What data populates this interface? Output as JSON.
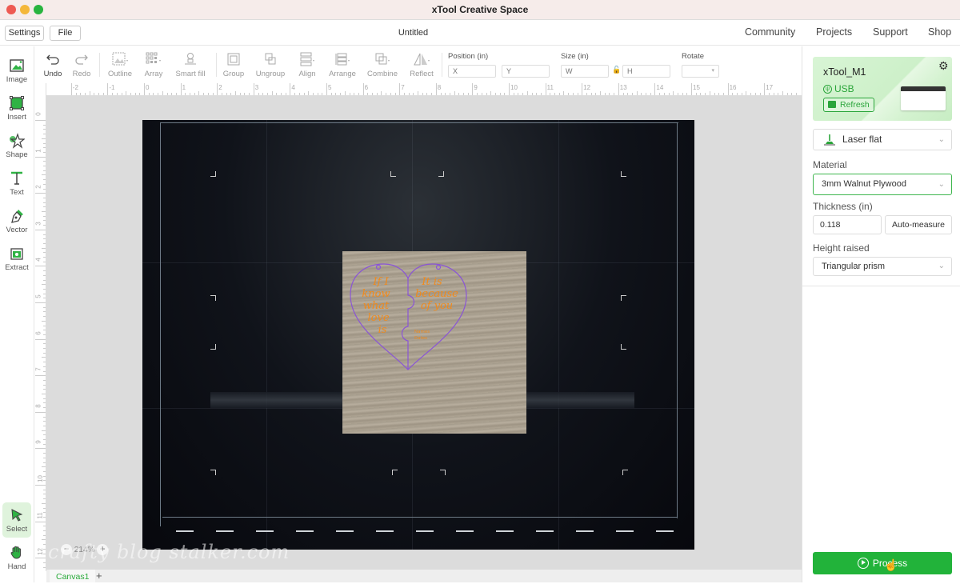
{
  "window": {
    "title": "xTool Creative Space"
  },
  "menubar": {
    "settings_label": "Settings",
    "file_label": "File",
    "document_title": "Untitled",
    "links": [
      "Community",
      "Projects",
      "Support",
      "Shop"
    ]
  },
  "left_tools": [
    {
      "label": "Image",
      "icon": "image-icon"
    },
    {
      "label": "Insert",
      "icon": "insert-icon"
    },
    {
      "label": "Shape",
      "icon": "shape-star-icon"
    },
    {
      "label": "Text",
      "icon": "text-icon"
    },
    {
      "label": "Vector",
      "icon": "pen-icon"
    },
    {
      "label": "Extract",
      "icon": "extract-icon"
    }
  ],
  "bottom_tools": [
    {
      "label": "Select",
      "icon": "cursor-icon",
      "active": true
    },
    {
      "label": "Hand",
      "icon": "hand-icon",
      "active": false
    }
  ],
  "toolbar": {
    "items": [
      {
        "label": "Undo",
        "enabled": true
      },
      {
        "label": "Redo",
        "enabled": false
      },
      {
        "label": "Outline",
        "enabled": false
      },
      {
        "label": "Array",
        "enabled": false
      },
      {
        "label": "Smart fill",
        "enabled": false
      },
      {
        "label": "Group",
        "enabled": false
      },
      {
        "label": "Ungroup",
        "enabled": false
      },
      {
        "label": "Align",
        "enabled": false
      },
      {
        "label": "Arrange",
        "enabled": false
      },
      {
        "label": "Combine",
        "enabled": false
      },
      {
        "label": "Reflect",
        "enabled": false
      }
    ],
    "position_label": "Position (in)",
    "x_placeholder": "X",
    "y_placeholder": "Y",
    "size_label": "Size (in)",
    "w_placeholder": "W",
    "h_placeholder": "H",
    "rotate_label": "Rotate",
    "rotate_value": ""
  },
  "ruler": {
    "h_ticks": [
      "-2",
      "-1",
      "0",
      "1",
      "2",
      "3",
      "4",
      "5",
      "6",
      "7",
      "8",
      "9",
      "10",
      "11",
      "12",
      "13",
      "14",
      "15",
      "16",
      "17"
    ],
    "v_ticks": [
      "0",
      "1",
      "2",
      "3",
      "4",
      "5",
      "6",
      "7",
      "8",
      "9",
      "10",
      "11",
      "12"
    ]
  },
  "canvas": {
    "zoom_level": "214%",
    "tabs": [
      "Canvas1"
    ],
    "add_tab_label": "+",
    "design_text_left": "If I know what love is",
    "design_text_right": "It is because of you",
    "design_text_small": "Names Dates",
    "colors": {
      "outline": "#8a55d6",
      "engrave_text": "#f08a1c"
    }
  },
  "watermark": "crafty blog stalker.com",
  "right_panel": {
    "device_name": "xTool_M1",
    "connection": "USB",
    "refresh_label": "Refresh",
    "mode": "Laser flat",
    "material_label": "Material",
    "material_value": "3mm Walnut Plywood",
    "thickness_label": "Thickness (in)",
    "thickness_value": "0.118",
    "auto_measure_label": "Auto-measure",
    "height_raised_label": "Height raised",
    "height_raised_value": "Triangular prism",
    "process_label": "Process",
    "accent_color": "#22b33a"
  }
}
